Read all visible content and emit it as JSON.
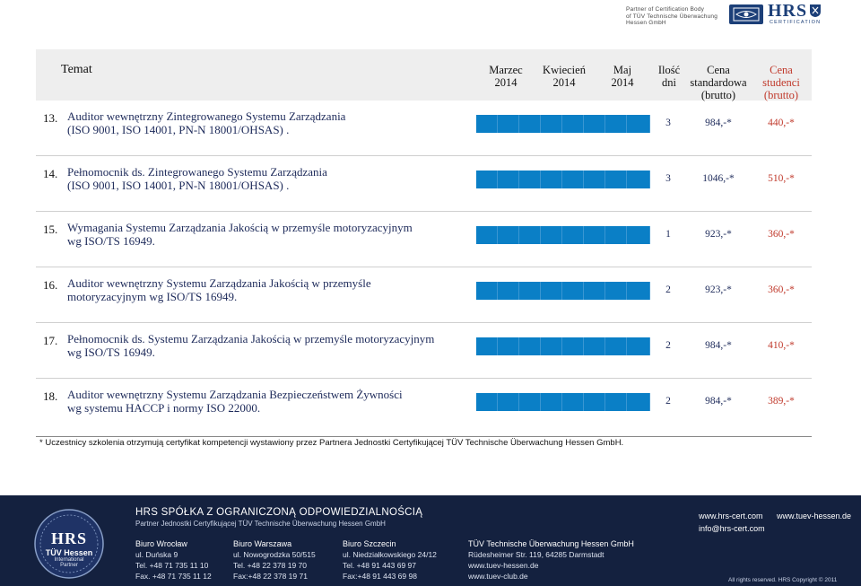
{
  "partner": {
    "line1": "Partner of Certification Body",
    "line2": "of TÜV Technische Überwachung",
    "line3": "Hessen GmbH",
    "logo_label": "HRS",
    "logo_sub": "CERTIFICATION"
  },
  "header": {
    "temat": "Temat",
    "months": [
      {
        "name": "Marzec",
        "year": "2014"
      },
      {
        "name": "Kwiecień",
        "year": "2014"
      },
      {
        "name": "Maj",
        "year": "2014"
      }
    ],
    "days": {
      "l1": "Ilość",
      "l2": "dni"
    },
    "price": {
      "l1": "Cena",
      "l2": "standardowa",
      "l3": "(brutto)"
    },
    "student_price": {
      "l1": "Cena",
      "l2": "studenci",
      "l3": "(brutto)"
    }
  },
  "rows": [
    {
      "num": "13.",
      "line1": "Auditor wewnętrzny Zintegrowanego Systemu Zarządzania",
      "line2": "(ISO 9001, ISO 14001, PN-N 18001/OHSAS) .",
      "days": "3",
      "price": "984,-*",
      "student_price": "440,-*"
    },
    {
      "num": "14.",
      "line1": "Pełnomocnik ds. Zintegrowanego Systemu Zarządzania",
      "line2": "(ISO 9001, ISO 14001, PN-N 18001/OHSAS) .",
      "days": "3",
      "price": "1046,-*",
      "student_price": "510,-*"
    },
    {
      "num": "15.",
      "line1": "Wymagania Systemu Zarządzania Jakością w przemyśle motoryzacyjnym",
      "line2": "wg ISO/TS 16949.",
      "days": "1",
      "price": "923,-*",
      "student_price": "360,-*"
    },
    {
      "num": "16.",
      "line1": "Auditor wewnętrzny Systemu Zarządzania Jakością w przemyśle",
      "line2": "motoryzacyjnym wg ISO/TS 16949.",
      "days": "2",
      "price": "923,-*",
      "student_price": "360,-*"
    },
    {
      "num": "17.",
      "line1": "Pełnomocnik ds. Systemu Zarządzania Jakością w przemyśle motoryzacyjnym",
      "line2": "wg ISO/TS 16949.",
      "days": "2",
      "price": "984,-*",
      "student_price": "410,-*"
    },
    {
      "num": "18.",
      "line1": "Auditor wewnętrzny Systemu Zarządzania Bezpieczeństwem Żywności",
      "line2": "wg systemu HACCP i normy ISO 22000.",
      "days": "2",
      "price": "984,-*",
      "student_price": "389,-*"
    }
  ],
  "footnote": "* Uczestnicy szkolenia otrzymują certyfikat kompetencji  wystawiony przez  Partnera Jednostki Certyfikującej TÜV Technische Überwachung Hessen GmbH.",
  "footer": {
    "company": "HRS SPÓŁKA Z OGRANICZONĄ ODPOWIEDZIALNOŚCIĄ",
    "partner": "Partner Jednostki Certyfikującej TÜV Technische Überwachung Hessen GmbH",
    "seal": {
      "hrs": "HRS",
      "tuv": "TÜV Hessen",
      "intl": "International",
      "partner": "Partner"
    },
    "offices": [
      {
        "head": "Biuro Wrocław",
        "l1": "ul. Duńska 9",
        "l2": "Tel. +48 71 735 11 10",
        "l3": "Fax. +48 71 735  11 12"
      },
      {
        "head": "Biuro Warszawa",
        "l1": "ul. Nowogrodzka 50/515",
        "l2": "Tel. +48 22 378 19 70",
        "l3": "Fax:+48 22 378 19 71"
      },
      {
        "head": "Biuro Szczecin",
        "l1": "ul. Niedziałkowskiego 24/12",
        "l2": "Tel. +48 91 443 69 97",
        "l3": "Fax:+48  91 443 69 98"
      },
      {
        "head": "TÜV Technische Überwachung Hessen GmbH",
        "l1": "Rüdesheimer Str. 119, 64285 Darmstadt",
        "l2": "www.tuev-hessen.de",
        "l3": "www.tuev-club.de"
      }
    ],
    "web1": "www.hrs-cert.com",
    "email": "info@hrs-cert.com",
    "web2": "www.tuev-hessen.de",
    "rights": "All rights reserved. HRS Copyright © 2011"
  },
  "colors": {
    "bar": "#0a7fc6",
    "student_price": "#c0392b",
    "footer_bg": "#14213f",
    "title_text": "#1d2a5a"
  }
}
